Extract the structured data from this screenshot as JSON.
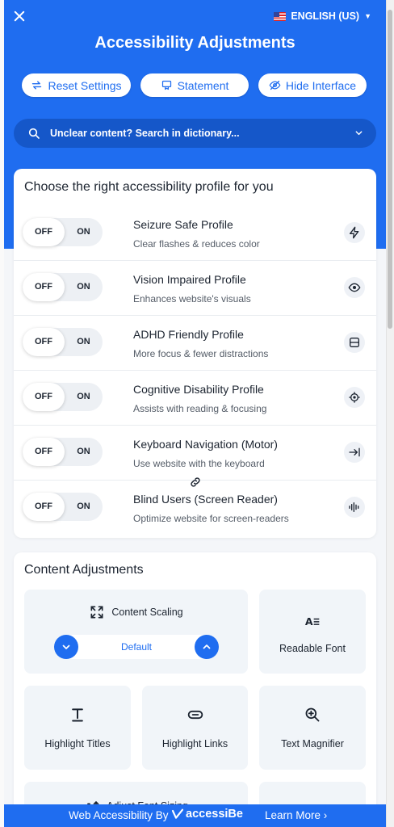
{
  "header": {
    "close_icon": "close-icon",
    "language": "ENGLISH (US)",
    "title": "Accessibility Adjustments",
    "buttons": {
      "reset": "Reset Settings",
      "statement": "Statement",
      "hide": "Hide Interface"
    }
  },
  "search": {
    "placeholder": "Unclear content? Search in dictionary..."
  },
  "profiles": {
    "title": "Choose the right accessibility profile for you",
    "off_label": "OFF",
    "on_label": "ON",
    "items": [
      {
        "name": "Seizure Safe Profile",
        "desc": "Clear flashes & reduces color",
        "icon": "lightning-icon"
      },
      {
        "name": "Vision Impaired Profile",
        "desc": "Enhances website's visuals",
        "icon": "eye-icon"
      },
      {
        "name": "ADHD Friendly Profile",
        "desc": "More focus & fewer distractions",
        "icon": "focus-frame-icon"
      },
      {
        "name": "Cognitive Disability Profile",
        "desc": "Assists with reading & focusing",
        "icon": "target-icon"
      },
      {
        "name": "Keyboard Navigation (Motor)",
        "desc": "Use website with the keyboard",
        "icon": "arrow-tab-icon"
      },
      {
        "name": "Blind Users (Screen Reader)",
        "desc": "Optimize website for screen-readers",
        "icon": "audio-wave-icon"
      }
    ]
  },
  "content": {
    "title": "Content Adjustments",
    "scaling": {
      "label": "Content Scaling",
      "value": "Default"
    },
    "tiles": {
      "readable_font": "Readable Font",
      "highlight_titles": "Highlight Titles",
      "highlight_links": "Highlight Links",
      "text_magnifier": "Text Magnifier",
      "adjust_font_sizing": "Adjust Font Sizing"
    }
  },
  "footer": {
    "label": "Web Accessibility By",
    "brand": "accessiBe",
    "learn_more": "Learn More ›"
  },
  "colors": {
    "accent": "#1f6df0",
    "search_bg": "#1557c9",
    "panel_bg": "#f4f6f9",
    "tile_bg": "#f1f5f9"
  }
}
